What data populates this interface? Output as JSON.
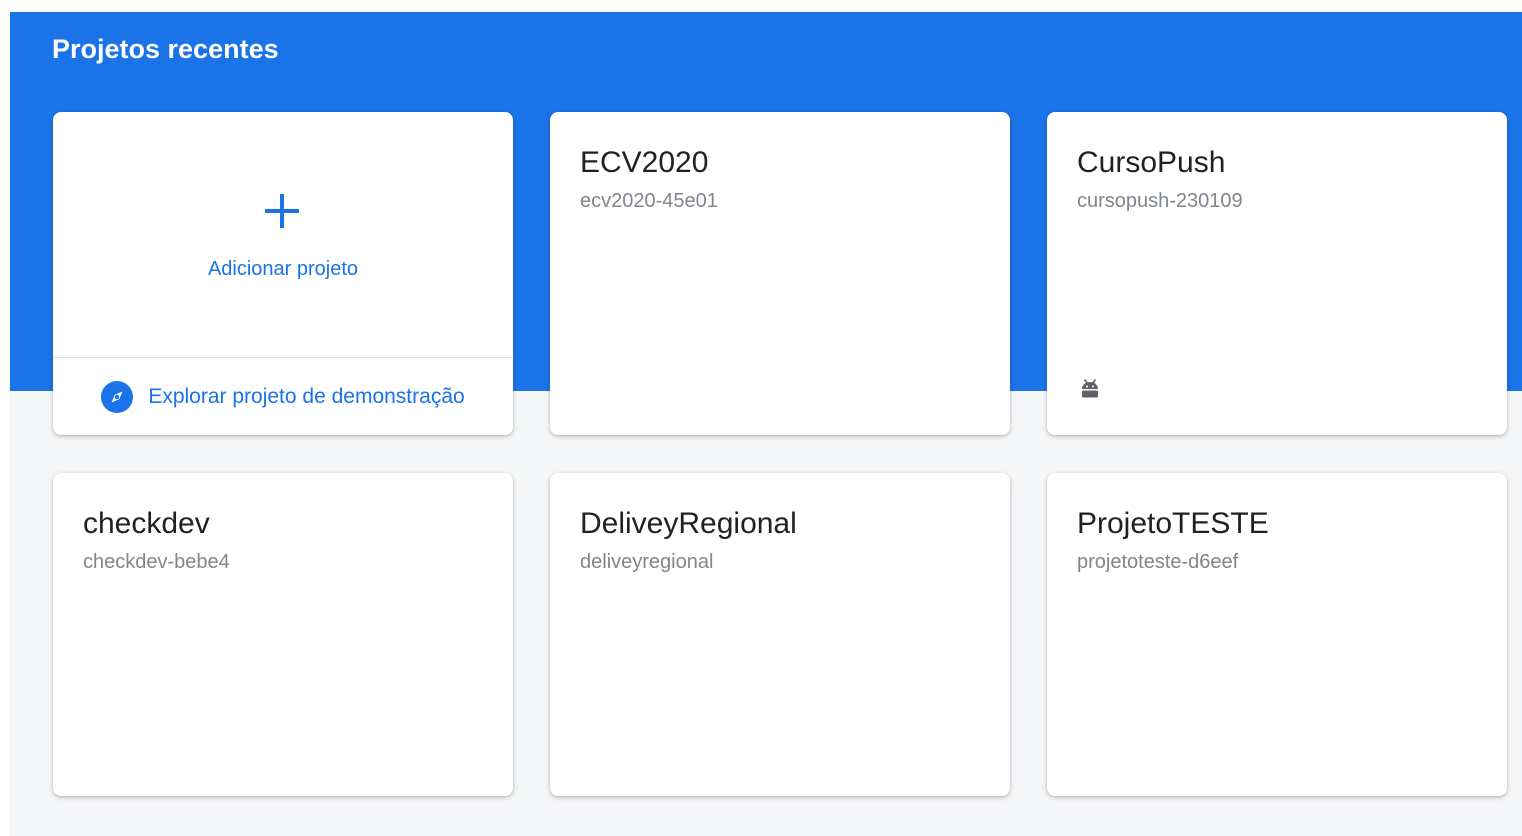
{
  "section": {
    "title": "Projetos recentes"
  },
  "add_card": {
    "add_label": "Adicionar projeto",
    "demo_label": "Explorar projeto de demonstração"
  },
  "projects": [
    {
      "name": "ECV2020",
      "id": "ecv2020-45e01",
      "platform_icon": ""
    },
    {
      "name": "CursoPush",
      "id": "cursopush-230109",
      "platform_icon": "android-icon"
    },
    {
      "name": "checkdev",
      "id": "checkdev-bebe4",
      "platform_icon": ""
    },
    {
      "name": "DeliveyRegional",
      "id": "deliveyregional",
      "platform_icon": ""
    },
    {
      "name": "ProjetoTESTE",
      "id": "projetoteste-d6eef",
      "platform_icon": ""
    }
  ],
  "colors": {
    "brand_blue": "#1a73e8",
    "background": "#f5f6f8",
    "card": "#ffffff",
    "title_text": "#202124",
    "secondary_text": "#80868b",
    "android_icon": "#5f6368"
  },
  "icons": {
    "add": "plus-icon",
    "demo": "compass-icon",
    "platform": "android-icon"
  }
}
